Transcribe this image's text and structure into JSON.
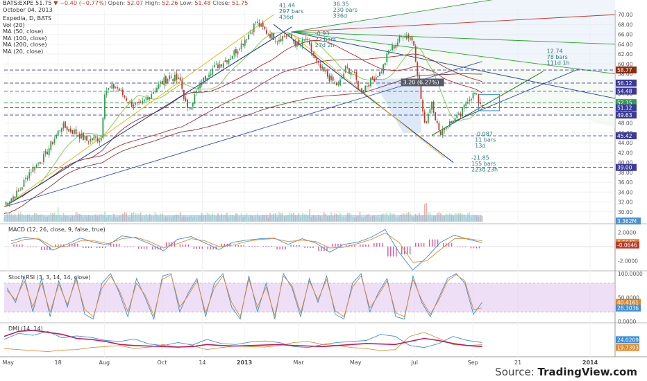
{
  "header": {
    "symbol": "BATS:EXPE",
    "last": "51.75",
    "change": "▼ −0.40 (−0.77%)",
    "open_label": "Open:",
    "open": "52.07",
    "high_label": "High:",
    "high": "52.26",
    "low_label": "Low:",
    "low": "51.48",
    "close_label": "Close:",
    "close": "51.75",
    "date": "October 04, 2013",
    "title": "Expedia, D, BATS",
    "studies": [
      "Vol (20)",
      "MA (50, close)",
      "MA (100, close)",
      "MA (200, close)",
      "MA (20, close)"
    ]
  },
  "panels": {
    "macd_label": "MACD (12, 26, close, 9, false, true)",
    "stoch_label": "Stoch RSI (3, 3, 14, 14, close)",
    "dmi_label": "DMI (14, 14)"
  },
  "source": {
    "prefix": "Source: ",
    "brand": "TradingView.com"
  },
  "colors": {
    "up": "#2e9e4f",
    "down": "#c0392b",
    "ma20": "#f5c518",
    "ma50": "#2aa12a",
    "ma100": "#b5282d",
    "ma200": "#8b3a3a",
    "trend_blue": "#1f3f9f",
    "hline": "#3a3a99",
    "stoch_band": "#e2c8f0",
    "vol": "#8fc0df"
  },
  "chart_data": [
    {
      "type": "candlestick",
      "title": "Expedia, D, BATS",
      "x_ticks": [
        "May",
        "18",
        "Aug",
        "Oct",
        "14",
        "2013",
        "Mar",
        "May",
        "Jul",
        "Sep",
        "21",
        "2014"
      ],
      "y_ticks": [
        30.0,
        32.0,
        34.0,
        36.0,
        38.0,
        40.0,
        42.0,
        44.0,
        46.0,
        48.0,
        50.0,
        52.0,
        54.0,
        56.0,
        58.0,
        60.0,
        62.0,
        64.0,
        66.0,
        68.0,
        70.0
      ],
      "ylim": [
        28.0,
        71.0
      ],
      "close_path": [
        [
          0,
          31.6
        ],
        [
          8,
          34.0
        ],
        [
          14,
          38.0
        ],
        [
          22,
          41.0
        ],
        [
          32,
          47.5
        ],
        [
          40,
          46.0
        ],
        [
          46,
          44.5
        ],
        [
          54,
          45.0
        ],
        [
          56,
          54.5
        ],
        [
          62,
          55.5
        ],
        [
          70,
          52.0
        ],
        [
          76,
          51.5
        ],
        [
          84,
          55.0
        ],
        [
          92,
          57.5
        ],
        [
          98,
          56.5
        ],
        [
          102,
          50.5
        ],
        [
          108,
          55.0
        ],
        [
          114,
          58.5
        ],
        [
          120,
          60.0
        ],
        [
          126,
          61.5
        ],
        [
          132,
          64.0
        ],
        [
          138,
          67.0
        ],
        [
          140,
          68.5
        ],
        [
          146,
          66.5
        ],
        [
          152,
          65.0
        ],
        [
          158,
          66.0
        ],
        [
          164,
          63.5
        ],
        [
          168,
          65.0
        ],
        [
          174,
          60.0
        ],
        [
          180,
          57.5
        ],
        [
          186,
          55.5
        ],
        [
          190,
          59.0
        ],
        [
          194,
          58.5
        ],
        [
          198,
          54.5
        ],
        [
          204,
          56.5
        ],
        [
          210,
          58.5
        ],
        [
          214,
          62.5
        ],
        [
          218,
          64.0
        ],
        [
          222,
          66.0
        ],
        [
          226,
          65.5
        ],
        [
          228,
          64.0
        ],
        [
          234,
          47.5
        ],
        [
          238,
          52.5
        ],
        [
          242,
          46.0
        ],
        [
          248,
          48.0
        ],
        [
          254,
          49.5
        ],
        [
          258,
          53.0
        ],
        [
          262,
          54.0
        ],
        [
          264,
          52.5
        ],
        [
          266,
          51.75
        ]
      ],
      "horizontal_levels": [
        {
          "price": 58.77,
          "label": "58.77",
          "color": "#8b2d0f"
        },
        {
          "price": 56.12,
          "label": "56.12",
          "color": "#3a3a99"
        },
        {
          "price": 54.48,
          "label": "54.48",
          "color": "#3a3a99"
        },
        {
          "price": 52.15,
          "label": "52.15",
          "color": "#2e9e4f"
        },
        {
          "price": 51.12,
          "label": "51.12",
          "color": "#3a3a99"
        },
        {
          "price": 49.63,
          "label": "49.63",
          "color": "#3a3a99"
        },
        {
          "price": 45.42,
          "label": "45.42",
          "color": "#3a3a99"
        },
        {
          "price": 39.0,
          "label": "39.00",
          "color": "#3a3a99"
        }
      ],
      "annotations": [
        {
          "lines": [
            "41.44",
            "297 bars",
            "436d"
          ],
          "color": "#2e7d7d"
        },
        {
          "lines": [
            "36.35",
            "230 bars",
            "336d"
          ],
          "color": "#2e7d7d"
        },
        {
          "lines": [
            "-0.93",
            "22 bars",
            "27d 2h"
          ],
          "color": "#2e7d7d"
        },
        {
          "lines": [
            "12.74",
            "78 bars",
            "111d 1h"
          ],
          "color": "#2e7d7d"
        },
        {
          "lines": [
            "3.20 (6.27%)"
          ],
          "color": "#ffffff"
        },
        {
          "lines": [
            "-0.087",
            "11 bars",
            "13d"
          ],
          "color": "#2e7d7d"
        },
        {
          "lines": [
            "-21.85",
            "155 bars",
            "223d 23h"
          ],
          "color": "#2e7d7d"
        }
      ],
      "volume_label": "3.362M"
    },
    {
      "type": "line",
      "title": "MACD (12, 26, close, 9, false, true)",
      "y_ticks": [
        2.0,
        -2.0
      ],
      "ylim": [
        -3.3,
        3.0
      ],
      "series": [
        {
          "name": "MACD",
          "color": "#3a8fd8",
          "last_label": "0.5643",
          "values": [
            0.8,
            1.3,
            1.0,
            -0.5,
            0.3,
            1.2,
            0.6,
            0.2,
            1.5,
            1.2,
            0.4,
            -0.6,
            1.0,
            1.4,
            0.5,
            -0.4,
            0.6,
            0.9,
            1.1,
            1.2,
            0.3,
            1.1,
            0.5,
            -0.8,
            0.3,
            0.6,
            1.3,
            2.4,
            -0.8,
            -3.3,
            -1.5,
            0.6,
            1.6,
            1.0,
            0.56
          ]
        },
        {
          "name": "Signal",
          "color": "#e08a2b",
          "last_label": "-0.0646",
          "values": [
            0.4,
            1.0,
            1.1,
            0.0,
            0.0,
            0.8,
            0.8,
            0.4,
            1.1,
            1.3,
            0.7,
            -0.2,
            0.4,
            1.1,
            0.8,
            0.0,
            0.2,
            0.7,
            1.0,
            1.1,
            0.7,
            0.9,
            0.7,
            -0.2,
            -0.1,
            0.4,
            1.0,
            1.9,
            0.6,
            -2.2,
            -2.0,
            -0.4,
            1.1,
            1.1,
            0.8
          ]
        }
      ]
    },
    {
      "type": "line",
      "title": "Stoch RSI (3, 3, 14, 14, close)",
      "y_ticks": [
        100.0,
        50.0,
        0.0
      ],
      "ylim": [
        0,
        100
      ],
      "band": [
        20,
        80
      ],
      "series": [
        {
          "name": "K",
          "color": "#3a8fd8",
          "last_label": "40.4161",
          "values": [
            70,
            40,
            95,
            20,
            90,
            10,
            85,
            30,
            95,
            15,
            5,
            80,
            100,
            60,
            10,
            90,
            50,
            5,
            95,
            100,
            20,
            60,
            90,
            10,
            80,
            100,
            30,
            5,
            95,
            20,
            80,
            5,
            100,
            70,
            10,
            90,
            40,
            95,
            15,
            5,
            80,
            100,
            20,
            60,
            90,
            10,
            5,
            95,
            40,
            10,
            50,
            90,
            100,
            80,
            15,
            40
          ]
        },
        {
          "name": "D",
          "color": "#e08a2b",
          "last_label": "28.3036",
          "values": [
            65,
            45,
            85,
            30,
            80,
            20,
            78,
            35,
            88,
            25,
            10,
            70,
            95,
            65,
            20,
            80,
            55,
            12,
            88,
            98,
            30,
            55,
            85,
            18,
            70,
            95,
            40,
            10,
            88,
            30,
            72,
            12,
            95,
            75,
            18,
            85,
            45,
            88,
            22,
            10,
            72,
            95,
            28,
            55,
            85,
            18,
            10,
            88,
            45,
            15,
            45,
            85,
            98,
            85,
            25,
            28
          ]
        }
      ]
    },
    {
      "type": "line",
      "title": "DMI (14, 14)",
      "ylim": [
        0,
        60
      ],
      "series": [
        {
          "name": "+DI",
          "color": "#3a8fd8",
          "last_label": "24.0209",
          "values": [
            30,
            42,
            38,
            46,
            33,
            37,
            34,
            28,
            26,
            31,
            21,
            18,
            24,
            19,
            30,
            22,
            20,
            25,
            27,
            24,
            16,
            14,
            20,
            24,
            26,
            28,
            40,
            36,
            18,
            14,
            22,
            36,
            28,
            24
          ]
        },
        {
          "name": "-DI",
          "color": "#e08a2b",
          "last_label": "19.7393",
          "values": [
            12,
            10,
            8,
            6,
            9,
            10,
            14,
            16,
            18,
            12,
            15,
            20,
            14,
            18,
            10,
            14,
            17,
            16,
            15,
            18,
            24,
            26,
            20,
            18,
            14,
            12,
            8,
            10,
            36,
            44,
            32,
            20,
            18,
            19.7
          ]
        },
        {
          "name": "ADX",
          "color": "#c2185b",
          "values": [
            36,
            46,
            48,
            44,
            40,
            32,
            30,
            26,
            20,
            18,
            17,
            16,
            15,
            16,
            20,
            18,
            17,
            18,
            19,
            20,
            18,
            17,
            16,
            18,
            20,
            22,
            21,
            20,
            26,
            32,
            28,
            22,
            18,
            16
          ]
        }
      ]
    }
  ]
}
